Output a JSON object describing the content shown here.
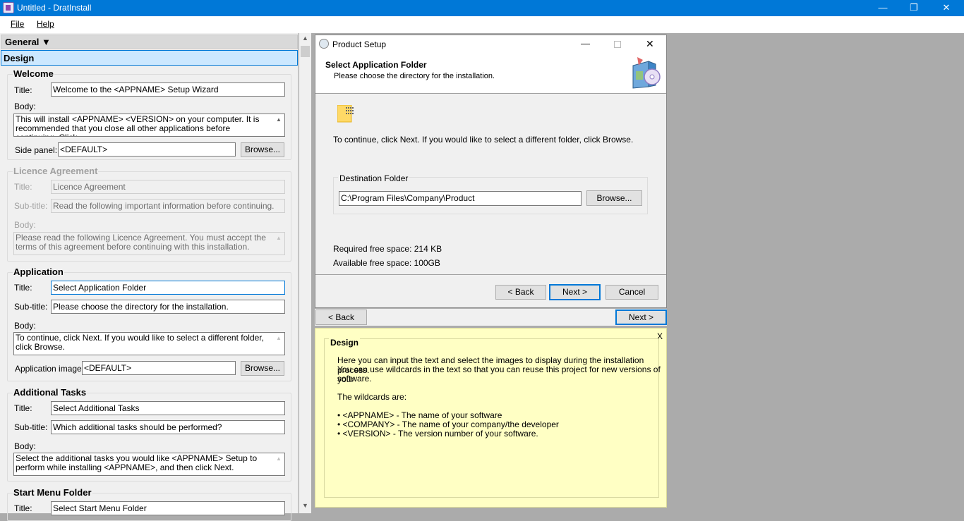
{
  "titlebar": {
    "title": "Untitled - DratInstall",
    "minimize": "—",
    "restore": "❐",
    "close": "✕"
  },
  "menu": {
    "file": "File",
    "help": "Help"
  },
  "left": {
    "general_label": "General ▼",
    "design_label": "Design",
    "welcome": {
      "title": "Welcome",
      "title_label": "Title:",
      "title_value": "Welcome to the <APPNAME> Setup Wizard",
      "body_label": "Body:",
      "body_value": "This will install <APPNAME> <VERSION> on your computer. It is recommended that you close all other applications before continuing. Click",
      "side_panel_label": "Side panel:",
      "side_panel_value": "<DEFAULT>",
      "browse": "Browse..."
    },
    "licence": {
      "title": "Licence Agreement",
      "title_label": "Title:",
      "title_value": "Licence Agreement",
      "subtitle_label": "Sub-title:",
      "subtitle_value": "Read the following important information before continuing.",
      "body_label": "Body:",
      "body_value": "Please read the following Licence Agreement. You must accept the terms of this agreement before continuing with this installation."
    },
    "application": {
      "title": "Application",
      "title_label": "Title:",
      "title_value": "Select Application Folder",
      "subtitle_label": "Sub-title:",
      "subtitle_value": "Please choose the directory for the installation.",
      "body_label": "Body:",
      "body_value": "To continue, click Next. If you would like to select a different folder, click Browse.",
      "image_label": "Application image:",
      "image_value": "<DEFAULT>",
      "browse": "Browse..."
    },
    "tasks": {
      "title": "Additional Tasks",
      "title_label": "Title:",
      "title_value": "Select Additional Tasks",
      "subtitle_label": "Sub-title:",
      "subtitle_value": "Which additional tasks should be performed?",
      "body_label": "Body:",
      "body_value": "Select the additional tasks you would like <APPNAME> Setup to perform while installing <APPNAME>, and then click Next."
    },
    "startmenu": {
      "title": "Start Menu Folder",
      "title_label": "Title:",
      "title_value": "Select Start Menu Folder"
    }
  },
  "setup": {
    "window_title": "Product Setup",
    "header_title": "Select Application Folder",
    "header_subtitle": "Please choose the directory for the installation.",
    "body_text": "To continue, click Next. If you would like to select a different folder, click Browse.",
    "dest_group": "Destination Folder",
    "dest_path": "C:\\Program Files\\Company\\Product",
    "browse": "Browse...",
    "required_space": "Required free space: 214 KB",
    "available_space": "Available free space: 100GB",
    "back": "< Back",
    "next": "Next >",
    "cancel": "Cancel"
  },
  "nav": {
    "back": "< Back",
    "next": "Next >"
  },
  "help": {
    "close": "X",
    "title": "Design",
    "line1": "Here you can input the text and select the images to display during the installation process.",
    "line2": "You can use wildcards in the text so that you can reuse this project for new versions of your",
    "line3": "software.",
    "line4": "The wildcards are:",
    "bullet1": "• <APPNAME> - The name of your software",
    "bullet2": "• <COMPANY> - The name of your company/the developer",
    "bullet3": "• <VERSION> - The version number of your software."
  }
}
